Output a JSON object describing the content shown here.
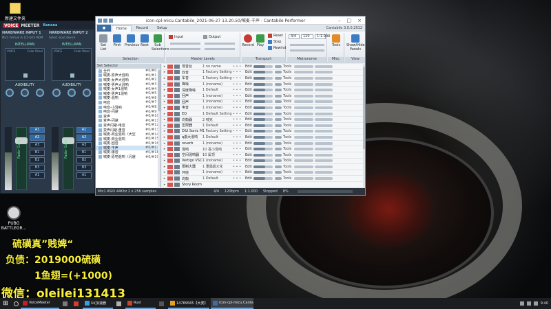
{
  "desktop": {
    "icons": [
      {
        "label": "新建文件夹"
      },
      {
        "label": "PUBG BATTLEGR..."
      }
    ]
  },
  "voicemeeter": {
    "brand_voice": "VOICE",
    "brand_meeter": "MEETER",
    "brand_banana": "Banana",
    "input1": {
      "title": "HARDWARE INPUT 1",
      "device": "Mic1 (Virtual In 1/2-4ch) MDM",
      "intelli": "INTELLIPAN",
      "voice": "VOICE",
      "color_panel": "Color Panel",
      "audibility": "AUDIBILITY",
      "fader": "Fader Gain",
      "fader_value": "0dB"
    },
    "input2": {
      "title": "HARDWARE INPUT 2",
      "device": "Select input device",
      "intelli": "INTELLIPAN",
      "voice": "VOICE",
      "color_panel": "Color Panel",
      "audibility": "AUDIBILITY",
      "fader": "Fader Gain",
      "fader_value": "0dB"
    },
    "buses": [
      "A1",
      "A2",
      "A3",
      "B1",
      "B2",
      "B3",
      "A1"
    ],
    "bus_states": [
      true,
      true,
      false,
      false,
      false,
      false,
      false
    ]
  },
  "cantabile": {
    "title": "icon-cpl-micu.Cantabile_2021-06-27 13.20.50/喊麦-干声 - Cantabile Performer",
    "app_button": "●",
    "tabs": [
      "Home",
      "Record",
      "Setup"
    ],
    "active_tab": "Home",
    "version": "Cantabile 3.0.0.2012",
    "ribbon": {
      "set_list": "Set List",
      "first": "First",
      "previous": "Previous",
      "next": "Next",
      "sub_sel": "Sub Selections",
      "input": "Input",
      "output": "Output",
      "record": "Record",
      "play": "Play",
      "reset": "Reset",
      "stop": "Stop",
      "rewind": "Rewind",
      "tools": "Tools",
      "show_hide": "Show/Hide Panels",
      "tempo": "120",
      "timesig": "4/4",
      "beat": "1:1.000",
      "groups": [
        "Selection",
        "Master Levels",
        "Transport",
        "Metronome",
        "Misc",
        "View"
      ]
    },
    "song_panel": {
      "header": "Set Selector",
      "rows": [
        {
          "name": "全开",
          "prog": "#0/#0"
        },
        {
          "name": "喊麦-原声大混响",
          "prog": "#0/#1"
        },
        {
          "name": "喊麦-女声大混响",
          "prog": "#0/#2"
        },
        {
          "name": "喊麦-男声大混响",
          "prog": "#0/#3"
        },
        {
          "name": "喊麦-女声1混响",
          "prog": "#0/#4"
        },
        {
          "name": "喊麦-男声1混响",
          "prog": "#0/#5"
        },
        {
          "name": "喊麦-混响",
          "prog": "#0/#6"
        },
        {
          "name": "电音",
          "prog": "#0/#7"
        },
        {
          "name": "电音-小混响",
          "prog": "#0/#8"
        },
        {
          "name": "电音-闪避",
          "prog": "#0/#9"
        },
        {
          "name": "变声",
          "prog": "#0/#10"
        },
        {
          "name": "变声-闪避",
          "prog": "#0/#11"
        },
        {
          "name": "变声闪避-电音",
          "prog": "#0/#12"
        },
        {
          "name": "变声闪避-重音",
          "prog": "#0/#13"
        },
        {
          "name": "喊麦-商业混响（大空",
          "prog": "#0/#14"
        },
        {
          "name": "喊麦-商业混响",
          "prog": "#0/#15"
        },
        {
          "name": "喊麦-回音",
          "prog": "#0/#16"
        },
        {
          "name": "喊麦-干声",
          "prog": "#0/#17"
        },
        {
          "name": "喊麦-爆音",
          "prog": "#0/#18"
        },
        {
          "name": "喊麦-原吧混响（闪避",
          "prog": "#0/#19"
        }
      ],
      "selected_index": 17
    },
    "racks": [
      {
        "name": "混音台",
        "state": "1 no name",
        "ctl": "• • •"
      },
      {
        "name": "双音",
        "state": "1 Factory Setting",
        "ctl": "• • •"
      },
      {
        "name": "车音",
        "state": "1 Factory Setting",
        "ctl": "• • •"
      },
      {
        "name": "降噪",
        "state": "1 (noname)",
        "ctl": "• • •"
      },
      {
        "name": "深度降噪",
        "state": "1 Default",
        "ctl": "• • •"
      },
      {
        "name": "回声",
        "state": "1 (noname)",
        "ctl": "• • •"
      },
      {
        "name": "回声",
        "state": "1 (noname)",
        "ctl": "• • •"
      },
      {
        "name": "电音",
        "state": "1 (noname)",
        "ctl": "• • •"
      },
      {
        "name": "EQ",
        "state": "1 Default Setting",
        "ctl": "• • •"
      },
      {
        "name": "均衡器",
        "state": "2 喊克",
        "ctl": "• • •"
      },
      {
        "name": "压限器",
        "state": "1 Default",
        "ctl": "• • •"
      },
      {
        "name": "D&I Sonic Maximizer",
        "state": "1 Factory Setting",
        "ctl": "• • •"
      },
      {
        "name": "q激大混响",
        "state": "1 Default",
        "ctl": "• • •"
      },
      {
        "name": "reverb",
        "state": "1 (noname)",
        "ctl": "• • •"
      },
      {
        "name": "混响",
        "state": "10 喜小混响",
        "ctl": "• • •"
      },
      {
        "name": "空间混响器",
        "state": "10 属顶",
        "ctl": "• • •"
      },
      {
        "name": "Vertigo VSC-2",
        "state": "1 (noname)",
        "ctl": "• • •"
      },
      {
        "name": "限制大器",
        "state": "1 重倡最大化",
        "ctl": "• • •"
      },
      {
        "name": "环绕",
        "state": "1 (noname)",
        "ctl": "• • •"
      },
      {
        "name": "均衡",
        "state": "1 Default",
        "ctl": "• • •"
      },
      {
        "name": "Story Room",
        "state": "",
        "ctl": ""
      }
    ],
    "rack_edit": "Edit",
    "rack_tools": "Tools",
    "status": {
      "device": "Mic1 ASIO 44Khz 2 x 256 samples",
      "timesig": "4/4",
      "tempo": "120bpm",
      "pos": "1:1.000",
      "state": "Stopped",
      "load": "8%"
    }
  },
  "overlay": {
    "line1": "硫磺真”贱婢“",
    "line2": "负债：2019000硫磺",
    "line3": "1鱼翅=(+1000)",
    "line4": "微信：oleilei131413"
  },
  "taskbar": {
    "start": "⊞",
    "tasks": [
      {
        "label": "VoiceMeeter",
        "color": "#c41e2b"
      },
      {
        "label": "",
        "color": "#7a7a7a"
      },
      {
        "label": "",
        "color": "#d63e2b"
      },
      {
        "label": "Ui(加速器",
        "color": "#34a0e0"
      },
      {
        "label": "",
        "color": "#b0b0b0"
      },
      {
        "label": "Rust",
        "color": "#cc4426"
      },
      {
        "label": "",
        "color": "#555555"
      },
      {
        "label": "14789565【大麦】",
        "color": "#e8a020"
      },
      {
        "label": "icon-cpl-micu.Cantab...",
        "color": "#3d6ea3"
      }
    ],
    "clock": "9:40"
  }
}
